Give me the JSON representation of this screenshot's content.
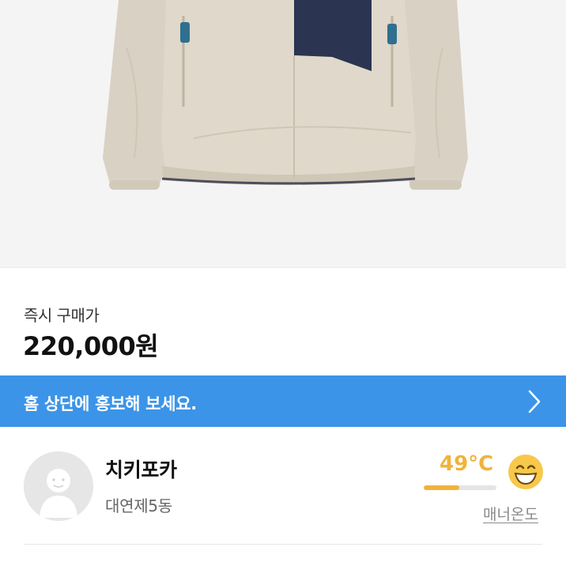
{
  "product": {
    "image_icon": "fleece-jacket-photo",
    "price_label": "즉시 구매가",
    "price_value": "220,000원"
  },
  "promo": {
    "text": "홈 상단에 홍보해 보세요.",
    "icon": "chevron-right-icon",
    "color": "#3b94e8"
  },
  "seller": {
    "name": "치키포카",
    "location": "대연제5동",
    "avatar_icon": "default-avatar-icon",
    "temperature": "49°C",
    "temperature_level": 0.49,
    "temperature_color": "#f0b33a",
    "emoji_icon": "smiling-face-icon",
    "manner_label": "매너온도"
  }
}
